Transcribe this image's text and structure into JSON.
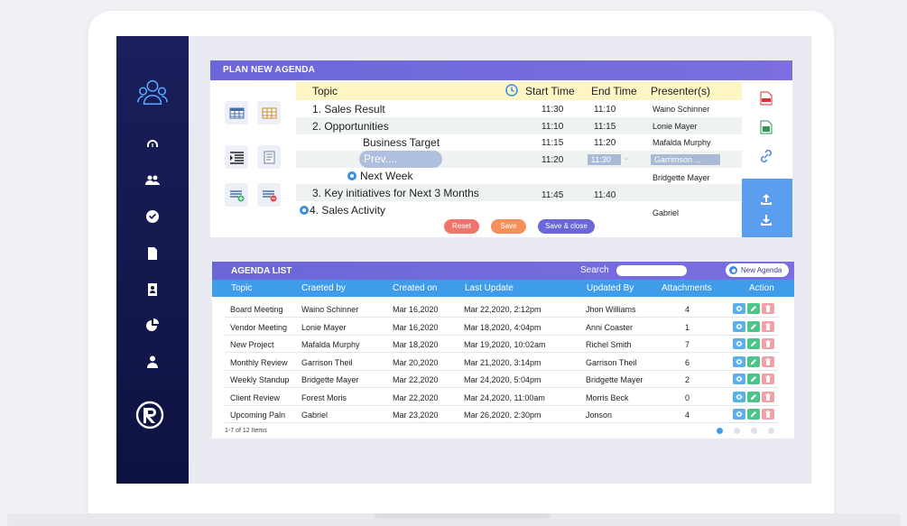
{
  "plan": {
    "header": "PLAN NEW AGENDA",
    "columns": {
      "topic": "Topic",
      "start": "Start Time",
      "end": "End Time",
      "presenter": "Presenter(s)"
    },
    "rows": [
      {
        "topic": "1. Sales Result",
        "start": "11:30",
        "end": "11:10",
        "presenter": "Waino Schinner"
      },
      {
        "topic": "2. Opportunities",
        "start": "11:10",
        "end": "11:15",
        "presenter": "Lonie Mayer"
      },
      {
        "topic": "Business Target",
        "start": "11:15",
        "end": "11:20",
        "presenter": "Mafalda Murphy"
      },
      {
        "topic": "Prev....",
        "start": "11:20",
        "end": "11:30",
        "presenter": "Garrimson ...",
        "extra": "-"
      },
      {
        "topic": "Next Week",
        "start": "",
        "end": "",
        "presenter": "Bridgette Mayer"
      },
      {
        "topic": "3. Key initiatives for Next 3 Months",
        "start": "11:45",
        "end": "11:40",
        "presenter": ""
      },
      {
        "topic": "4. Sales Activity",
        "start": "",
        "end": "",
        "presenter": "Gabriel"
      }
    ],
    "buttons": {
      "reset": "Reset",
      "save": "Save",
      "save_close": "Save & close"
    }
  },
  "agenda": {
    "header": "AGENDA LIST",
    "search_label": "Search",
    "search_value": "",
    "new_label": "New Agenda",
    "columns": [
      "Topic",
      "Craeted by",
      "Created on",
      "Last Update",
      "Updated By",
      "Attachments",
      "Action"
    ],
    "rows": [
      [
        "Board Meeting",
        "Waino Schinner",
        "Mar 16,2020",
        "Mar 22,2020, 2:12pm",
        "Jhon Williams",
        "4"
      ],
      [
        "Vendor Meeting",
        "Lonie Mayer",
        "Mar 16,2020",
        "Mar 18,2020, 4:04pm",
        "Anni Coaster",
        "1"
      ],
      [
        "New Project",
        "Mafalda Murphy",
        "Mar 18,2020",
        "Mar 19,2020, 10:02am",
        "Richel Smith",
        "7"
      ],
      [
        "Monthly Review",
        "Garrison Theil",
        "Mar 20,2020",
        "Mar 21,2020, 3:14pm",
        "Garrison Theil",
        "6"
      ],
      [
        "Weekly Standup",
        "Bridgette Mayer",
        "Mar 22,2020",
        "Mar 24,2020, 5:04pm",
        "Bridgette Mayer",
        "2"
      ],
      [
        "Client Review",
        "Forest Moris",
        "Mar 22,2020",
        "Mar 24,2020, 11:00am",
        "Morris Beck",
        "0"
      ],
      [
        "Upcoming Paln",
        "Gabriel",
        "Mar 23,2020",
        "Mar 26,2020, 2:30pm",
        "Jonson",
        "4"
      ]
    ],
    "footer": "1-7 of 12 Items"
  },
  "colors": {
    "accent": "#6b67d8",
    "table_head": "#3f9ce8",
    "sidebar": "#12164a",
    "reset": "#f2736b",
    "save": "#f58f5c",
    "save_close": "#6b67d8"
  },
  "icons": {
    "sidebar": [
      "team-logo-icon",
      "dashboard-gauge-icon",
      "users-icon",
      "check-circle-icon",
      "document-icon",
      "contacts-icon",
      "pie-chart-icon",
      "person-icon",
      "brand-r-logo"
    ],
    "tools": [
      "table-icon",
      "grid-icon",
      "indent-list-icon",
      "notes-icon",
      "add-row-icon",
      "remove-row-icon"
    ],
    "right": [
      "pdf-icon",
      "excel-icon",
      "link-icon",
      "upload-icon",
      "download-icon"
    ],
    "actions": [
      "view-icon",
      "edit-icon",
      "delete-icon"
    ]
  }
}
